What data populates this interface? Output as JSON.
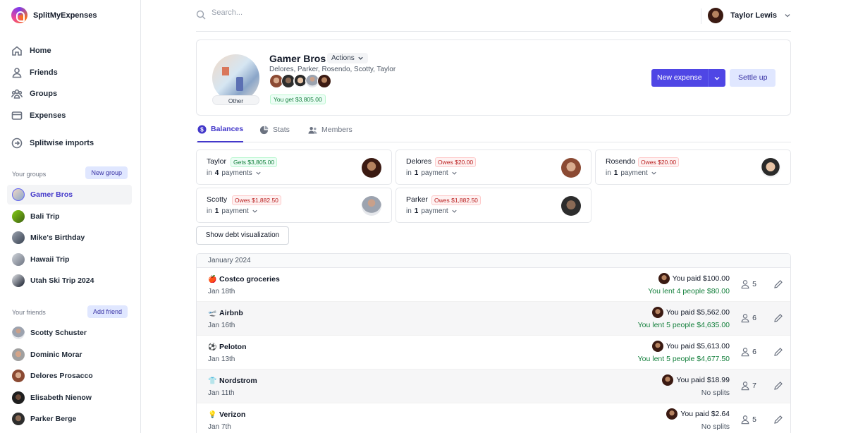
{
  "app": {
    "name": "SplitMyExpenses"
  },
  "nav": [
    {
      "label": "Home",
      "icon": "home-icon"
    },
    {
      "label": "Friends",
      "icon": "user-icon"
    },
    {
      "label": "Groups",
      "icon": "users-icon"
    },
    {
      "label": "Expenses",
      "icon": "credit-card-icon"
    },
    {
      "label": "Splitwise imports",
      "icon": "import-icon"
    }
  ],
  "groups_section": {
    "title": "Your groups",
    "button": "New group"
  },
  "groups": [
    {
      "name": "Gamer Bros",
      "active": true
    },
    {
      "name": "Bali Trip"
    },
    {
      "name": "Mike's Birthday"
    },
    {
      "name": "Hawaii Trip"
    },
    {
      "name": "Utah Ski Trip 2024"
    }
  ],
  "friends_section": {
    "title": "Your friends",
    "button": "Add friend"
  },
  "friends": [
    {
      "name": "Scotty Schuster"
    },
    {
      "name": "Dominic Morar"
    },
    {
      "name": "Delores Prosacco"
    },
    {
      "name": "Elisabeth Nienow"
    },
    {
      "name": "Parker Berge"
    }
  ],
  "topbar": {
    "search_placeholder": "Search...",
    "user_name": "Taylor Lewis"
  },
  "group": {
    "title": "Gamer Bros",
    "actions_label": "Actions",
    "members_line": "Delores, Parker, Rosendo, Scotty, Taylor",
    "photo_label": "Other",
    "balance_label": "You get $3,805.00",
    "new_expense_label": "New expense",
    "settle_label": "Settle up"
  },
  "tabs": [
    {
      "label": "Balances",
      "icon": "dollar-icon",
      "active": true
    },
    {
      "label": "Stats",
      "icon": "pie-chart-icon"
    },
    {
      "label": "Members",
      "icon": "users-icon"
    }
  ],
  "balances": [
    {
      "name": "Taylor",
      "badge": "Gets $3,805.00",
      "kind": "gets",
      "prefix": "in",
      "count": "4",
      "suffix": "payments"
    },
    {
      "name": "Delores",
      "badge": "Owes $20.00",
      "kind": "owes",
      "prefix": "in",
      "count": "1",
      "suffix": "payment"
    },
    {
      "name": "Rosendo",
      "badge": "Owes $20.00",
      "kind": "owes",
      "prefix": "in",
      "count": "1",
      "suffix": "payment"
    },
    {
      "name": "Scotty",
      "badge": "Owes $1,882.50",
      "kind": "owes",
      "prefix": "in",
      "count": "1",
      "suffix": "payment"
    },
    {
      "name": "Parker",
      "badge": "Owes $1,882.50",
      "kind": "owes",
      "prefix": "in",
      "count": "1",
      "suffix": "payment"
    }
  ],
  "debt_button": "Show debt visualization",
  "month": "January 2024",
  "expenses": [
    {
      "emoji": "🍎",
      "title": "Costco groceries",
      "date": "Jan 18th",
      "paid": "You paid $100.00",
      "lent": "You lent 4 people $80.00",
      "count": "5"
    },
    {
      "emoji": "🛫",
      "title": "Airbnb",
      "date": "Jan 16th",
      "paid": "You paid $5,562.00",
      "lent": "You lent 5 people $4,635.00",
      "count": "6"
    },
    {
      "emoji": "⚽",
      "title": "Peloton",
      "date": "Jan 13th",
      "paid": "You paid $5,613.00",
      "lent": "You lent 5 people $4,677.50",
      "count": "6"
    },
    {
      "emoji": "👕",
      "title": "Nordstrom",
      "date": "Jan 11th",
      "paid": "You paid $18.99",
      "lent": "No splits",
      "count": "7"
    },
    {
      "emoji": "💡",
      "title": "Verizon",
      "date": "Jan 7th",
      "paid": "You paid $2.64",
      "lent": "No splits",
      "count": "5"
    }
  ]
}
